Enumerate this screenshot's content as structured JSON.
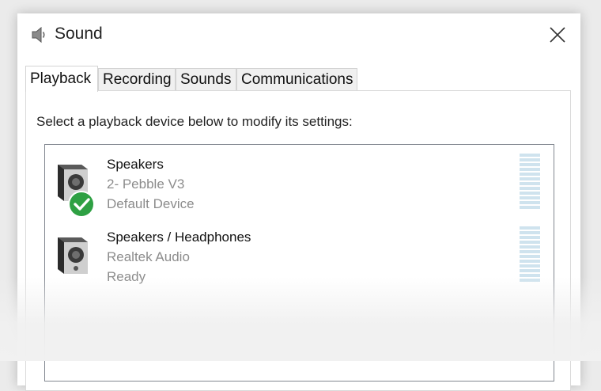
{
  "window": {
    "title": "Sound",
    "icon": "speaker-icon",
    "close_icon": "close-icon"
  },
  "tabs": [
    {
      "label": "Playback",
      "active": true
    },
    {
      "label": "Recording",
      "active": false
    },
    {
      "label": "Sounds",
      "active": false
    },
    {
      "label": "Communications",
      "active": false
    }
  ],
  "playback": {
    "instruction": "Select a playback device below to modify its settings:",
    "devices": [
      {
        "name": "Speakers",
        "description": "2- Pebble V3",
        "status": "Default Device",
        "is_default": true,
        "icon": "speaker-icon"
      },
      {
        "name": "Speakers / Headphones",
        "description": "Realtek Audio",
        "status": "Ready",
        "is_default": false,
        "icon": "speaker-icon"
      }
    ]
  },
  "colors": {
    "default_check": "#2ea043",
    "meter": "#cfe3ee",
    "secondary_text": "#8c8c8c"
  }
}
